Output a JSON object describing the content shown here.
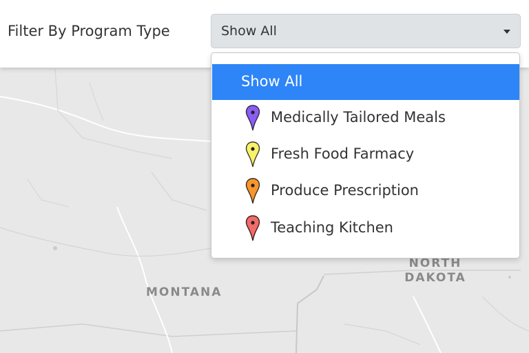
{
  "filter": {
    "label": "Filter By Program Type",
    "selected_value": "Show All"
  },
  "dropdown": {
    "options": [
      {
        "label": "Show All",
        "selected": true
      },
      {
        "label": "Medically Tailored Meals",
        "icon": "purple-map-pin-icon",
        "color": "#8a5cf5"
      },
      {
        "label": "Fresh Food Farmacy",
        "icon": "yellow-map-pin-icon",
        "color": "#f7f26a"
      },
      {
        "label": "Produce Prescription",
        "icon": "orange-map-pin-icon",
        "color": "#f7962e"
      },
      {
        "label": "Teaching Kitchen",
        "icon": "red-map-pin-icon",
        "color": "#f26a6a"
      }
    ],
    "highlight_color": "#2d85f7"
  },
  "map": {
    "labels": {
      "montana": "MONTANA",
      "north_dakota_line1": "NORTH",
      "north_dakota_line2": "DAKOTA"
    },
    "edge_marker": {
      "icon": "orange-map-pin-icon",
      "color": "#f7962e"
    }
  }
}
